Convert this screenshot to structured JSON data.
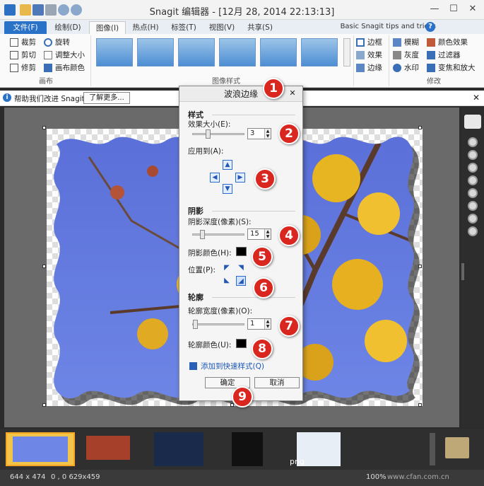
{
  "window": {
    "title": "Snagit 编辑器 - [12月 28, 2014 22:13:13]",
    "controls": [
      "—",
      "☐",
      "✕"
    ]
  },
  "tabs": [
    {
      "label": "文件(F)"
    },
    {
      "label": "绘制(D)"
    },
    {
      "label": "图像(I)"
    },
    {
      "label": "热点(H)"
    },
    {
      "label": "标签(T)"
    },
    {
      "label": "视图(V)"
    },
    {
      "label": "共享(S)"
    }
  ],
  "tips_link": "Basic Snagit tips and tricks",
  "help_glyph": "?",
  "ribbon": {
    "canvas": {
      "label": "画布",
      "items": [
        "裁剪",
        "旋转",
        "剪切",
        "调整大小",
        "修剪",
        "画布颜色"
      ]
    },
    "style": {
      "label": "图像样式"
    },
    "edge": {
      "items": [
        "边框",
        "效果",
        "边缘"
      ]
    },
    "modify": {
      "label": "修改",
      "items": [
        "模糊",
        "灰度",
        "水印",
        "颜色效果",
        "过滤器",
        "变焦和放大"
      ]
    }
  },
  "notice": {
    "text": "帮助我们改进 Snagit",
    "button": "了解更多...",
    "close": "✕"
  },
  "dialog": {
    "title": "波浪边缘",
    "close": "✕",
    "style_section": "样式",
    "effect_size_label": "效果大小(E):",
    "effect_size_value": "3",
    "apply_to_label": "应用到(A):",
    "shadow_section": "阴影",
    "shadow_depth_label": "阴影深度(像素)(S):",
    "shadow_depth_value": "15",
    "shadow_color_label": "阴影颜色(H):",
    "position_label": "位置(P):",
    "outline_section": "轮廓",
    "outline_width_label": "轮廓宽度(像素)(O):",
    "outline_width_value": "1",
    "outline_color_label": "轮廓颜色(U):",
    "add_quick_style": "添加到快速样式(Q)",
    "ok": "确定",
    "cancel": "取消"
  },
  "callouts": [
    "1",
    "2",
    "3",
    "4",
    "5",
    "6",
    "7",
    "8",
    "9"
  ],
  "tray": {
    "png_label": "png"
  },
  "status": {
    "size": "644 x 474",
    "coords": "0 , 0  629x459",
    "zoom": "100%"
  },
  "watermark": "www.cfan.com.cn",
  "colors": {
    "accent": "#2a72c8",
    "badge": "#d9261f",
    "shadow_color": "#000000",
    "outline_color": "#000000"
  }
}
